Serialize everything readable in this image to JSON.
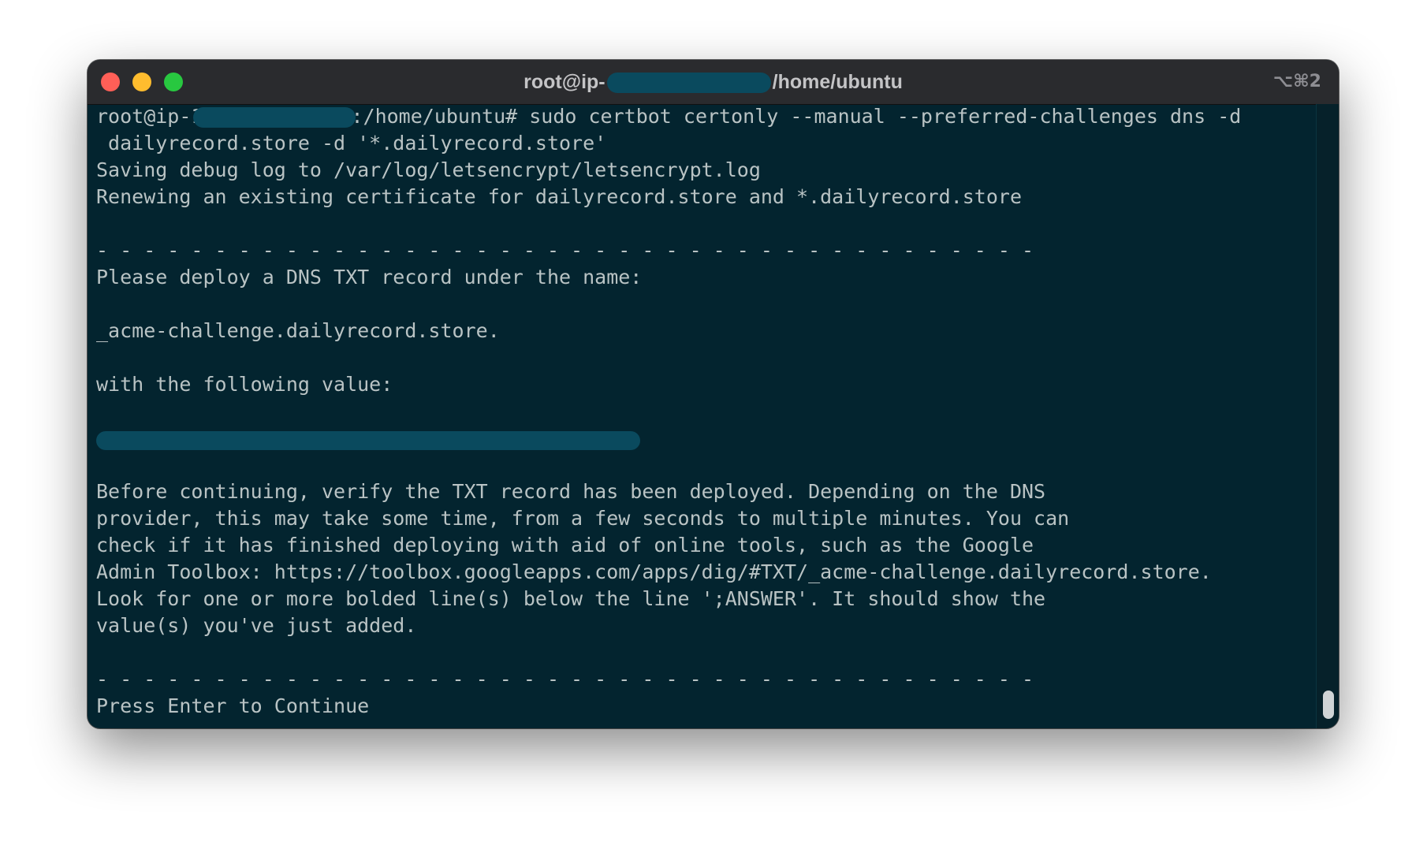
{
  "window": {
    "title_prefix": "root@ip-",
    "title_suffix": "/home/ubuntu",
    "shortcut": "⌥⌘2"
  },
  "terminal": {
    "prompt_prefix": "root@ip-1",
    "prompt_suffix": ":/home/ubuntu# sudo certbot certonly --manual --preferred-challenges dns -d",
    "lines": [
      " dailyrecord.store -d '*.dailyrecord.store'",
      "Saving debug log to /var/log/letsencrypt/letsencrypt.log",
      "Renewing an existing certificate for dailyrecord.store and *.dailyrecord.store",
      "",
      "- - - - - - - - - - - - - - - - - - - - - - - - - - - - - - - - - - - - - - - -",
      "Please deploy a DNS TXT record under the name:",
      "",
      "_acme-challenge.dailyrecord.store.",
      "",
      "with the following value:",
      "",
      "[REDACTED]",
      "",
      "Before continuing, verify the TXT record has been deployed. Depending on the DNS",
      "provider, this may take some time, from a few seconds to multiple minutes. You can",
      "check if it has finished deploying with aid of online tools, such as the Google",
      "Admin Toolbox: https://toolbox.googleapps.com/apps/dig/#TXT/_acme-challenge.dailyrecord.store.",
      "Look for one or more bolded line(s) below the line ';ANSWER'. It should show the",
      "value(s) you've just added.",
      "",
      "- - - - - - - - - - - - - - - - - - - - - - - - - - - - - - - - - - - - - - - -",
      "Press Enter to Continue"
    ]
  }
}
